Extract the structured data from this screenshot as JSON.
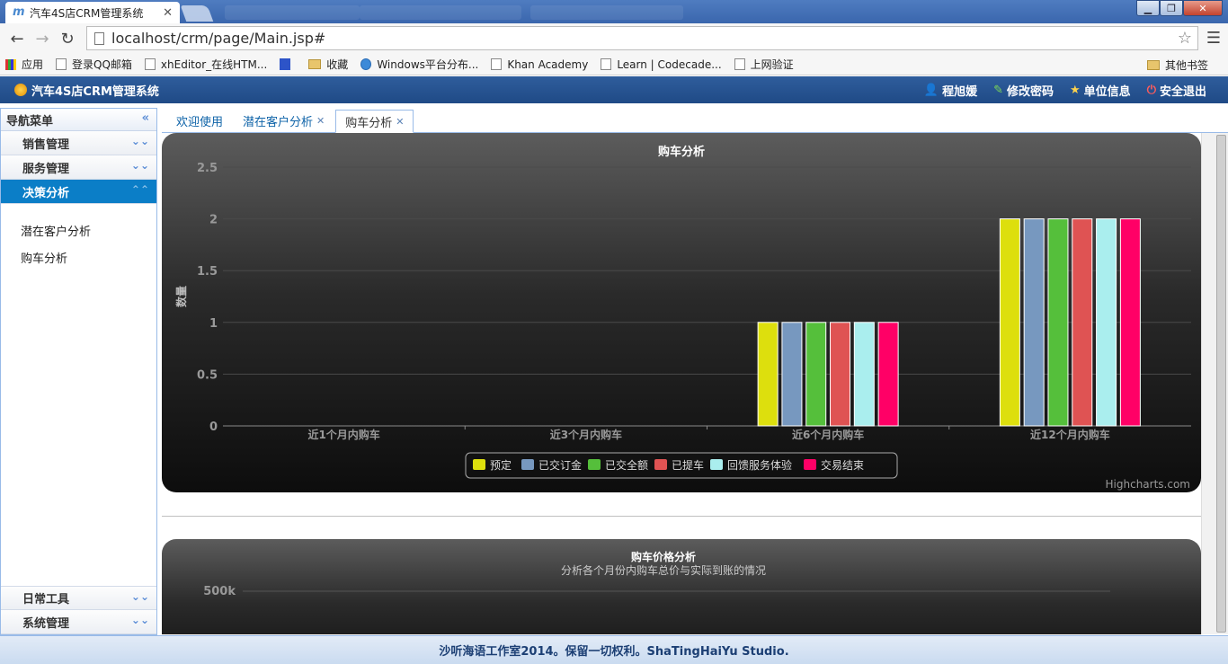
{
  "browser": {
    "tab_title": "汽车4S店CRM管理系统",
    "url": "localhost/crm/page/Main.jsp#",
    "bookmarks": [
      "应用",
      "登录QQ邮箱",
      "xhEditor_在线HTM...",
      "收藏",
      "Windows平台分布...",
      "Khan Academy",
      "Learn | Codecade...",
      "上网验证"
    ],
    "other_bookmarks": "其他书签"
  },
  "app": {
    "title": "汽车4S店CRM管理系统",
    "user": "程旭媛",
    "change_password": "修改密码",
    "unit_info": "单位信息",
    "logout": "安全退出"
  },
  "sidebar": {
    "header": "导航菜单",
    "groups": [
      "销售管理",
      "服务管理",
      "决策分析"
    ],
    "subitems": [
      "潜在客户分析",
      "购车分析"
    ],
    "bottom_groups": [
      "日常工具",
      "系统管理"
    ]
  },
  "tabs": [
    {
      "label": "欢迎使用"
    },
    {
      "label": "潜在客户分析"
    },
    {
      "label": "购车分析"
    }
  ],
  "chart_data": [
    {
      "type": "bar",
      "title": "购车分析",
      "ylabel": "数量",
      "categories": [
        "近1个月内购车",
        "近3个月内购车",
        "近6个月内购车",
        "近12个月内购车"
      ],
      "yticks": [
        "0",
        "0.5",
        "1",
        "1.5",
        "2",
        "2.5"
      ],
      "ylim": [
        0,
        2.5
      ],
      "series": [
        {
          "name": "预定",
          "color": "#dddf0d",
          "values": [
            0,
            0,
            1,
            2
          ]
        },
        {
          "name": "已交订金",
          "color": "#7798bf",
          "values": [
            0,
            0,
            1,
            2
          ]
        },
        {
          "name": "已交全额",
          "color": "#55bf3b",
          "values": [
            0,
            0,
            1,
            2
          ]
        },
        {
          "name": "已提车",
          "color": "#df5353",
          "values": [
            0,
            0,
            1,
            2
          ]
        },
        {
          "name": "回馈服务体验",
          "color": "#aaeeee",
          "values": [
            0,
            0,
            1,
            2
          ]
        },
        {
          "name": "交易结束",
          "color": "#ff0066",
          "values": [
            0,
            0,
            1,
            2
          ]
        }
      ],
      "legend": "bottom-center",
      "credits": "Highcharts.com"
    },
    {
      "type": "line",
      "title": "购车价格分析",
      "subtitle": "分析各个月份内购车总价与实际到账的情况",
      "yticks": [
        "500k"
      ]
    }
  ],
  "footer": "沙听海语工作室2014。保留一切权利。ShaTingHaiYu Studio."
}
